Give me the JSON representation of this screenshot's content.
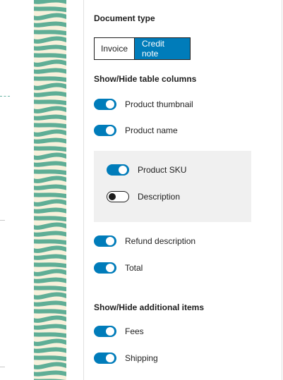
{
  "document_type": {
    "heading": "Document type",
    "options": [
      "Invoice",
      "Credit note"
    ],
    "selected": "Credit note"
  },
  "columns": {
    "heading": "Show/Hide table columns",
    "items": [
      {
        "label": "Product thumbnail",
        "enabled": true
      },
      {
        "label": "Product name",
        "enabled": true
      },
      {
        "label": "Product SKU",
        "enabled": true
      },
      {
        "label": "Description",
        "enabled": false
      },
      {
        "label": "Refund description",
        "enabled": true
      },
      {
        "label": "Total",
        "enabled": true
      }
    ]
  },
  "additional": {
    "heading": "Show/Hide additional items",
    "items": [
      {
        "label": "Fees",
        "enabled": true
      },
      {
        "label": "Shipping",
        "enabled": true
      }
    ]
  },
  "colors": {
    "accent": "#007cba",
    "pattern_green": "#5fae96",
    "pattern_cream": "#f8f1dc",
    "nested_bg": "#f0f0f0"
  }
}
